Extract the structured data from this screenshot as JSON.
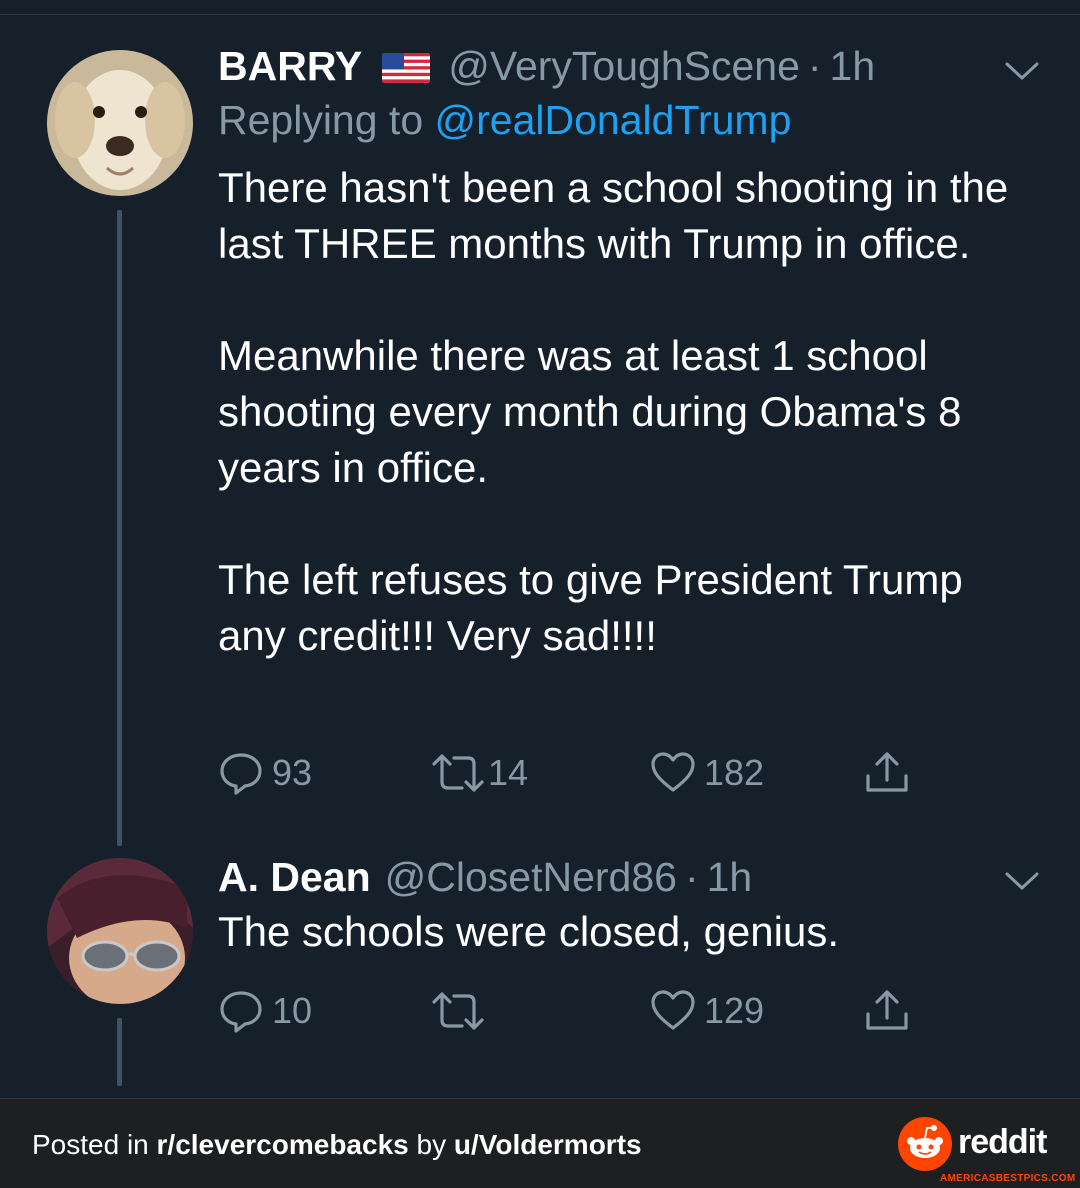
{
  "tweet1": {
    "name": "BARRY",
    "flag_icon": "us-flag-icon",
    "handle": "@VeryToughScene",
    "separator": "·",
    "time": "1h",
    "replying_prefix": "Replying to",
    "replying_to": "@realDonaldTrump",
    "paragraphs": [
      "There hasn't been a school shooting in the last THREE months with Trump in office.",
      "Meanwhile there was at least 1 school shooting every month during Obama's 8 years in office.",
      "The left refuses to give President Trump any credit!!! Very sad!!!!"
    ],
    "replies": "93",
    "retweets": "14",
    "likes": "182"
  },
  "tweet2": {
    "name": "A. Dean",
    "handle": "@ClosetNerd86",
    "separator": "·",
    "time": "1h",
    "text": "The schools were closed, genius.",
    "replies": "10",
    "retweets": "",
    "likes": "129"
  },
  "footer": {
    "posted_in": "Posted in",
    "subreddit": "r/clevercomebacks",
    "by": "by",
    "user": "u/Voldermorts",
    "brand": "reddit",
    "watermark": "AMERICASBESTPICS.COM"
  },
  "colors": {
    "background": "#15202b",
    "secondary_text": "#8899a6",
    "link": "#1da1f2",
    "reddit_orange": "#ff4500"
  }
}
